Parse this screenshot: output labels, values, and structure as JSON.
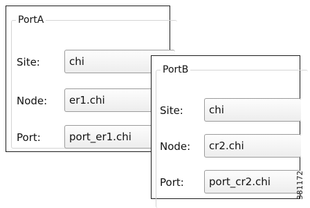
{
  "port_a": {
    "title": "PortA",
    "site_label": "Site:",
    "site_value": "chi",
    "node_label": "Node:",
    "node_value": "er1.chi",
    "port_label": "Port:",
    "port_value": "port_er1.chi"
  },
  "port_b": {
    "title": "PortB",
    "site_label": "Site:",
    "site_value": "chi",
    "node_label": "Node:",
    "node_value": "cr2.chi",
    "port_label": "Port:",
    "port_value": "port_cr2.chi"
  },
  "figure_number": "381172"
}
